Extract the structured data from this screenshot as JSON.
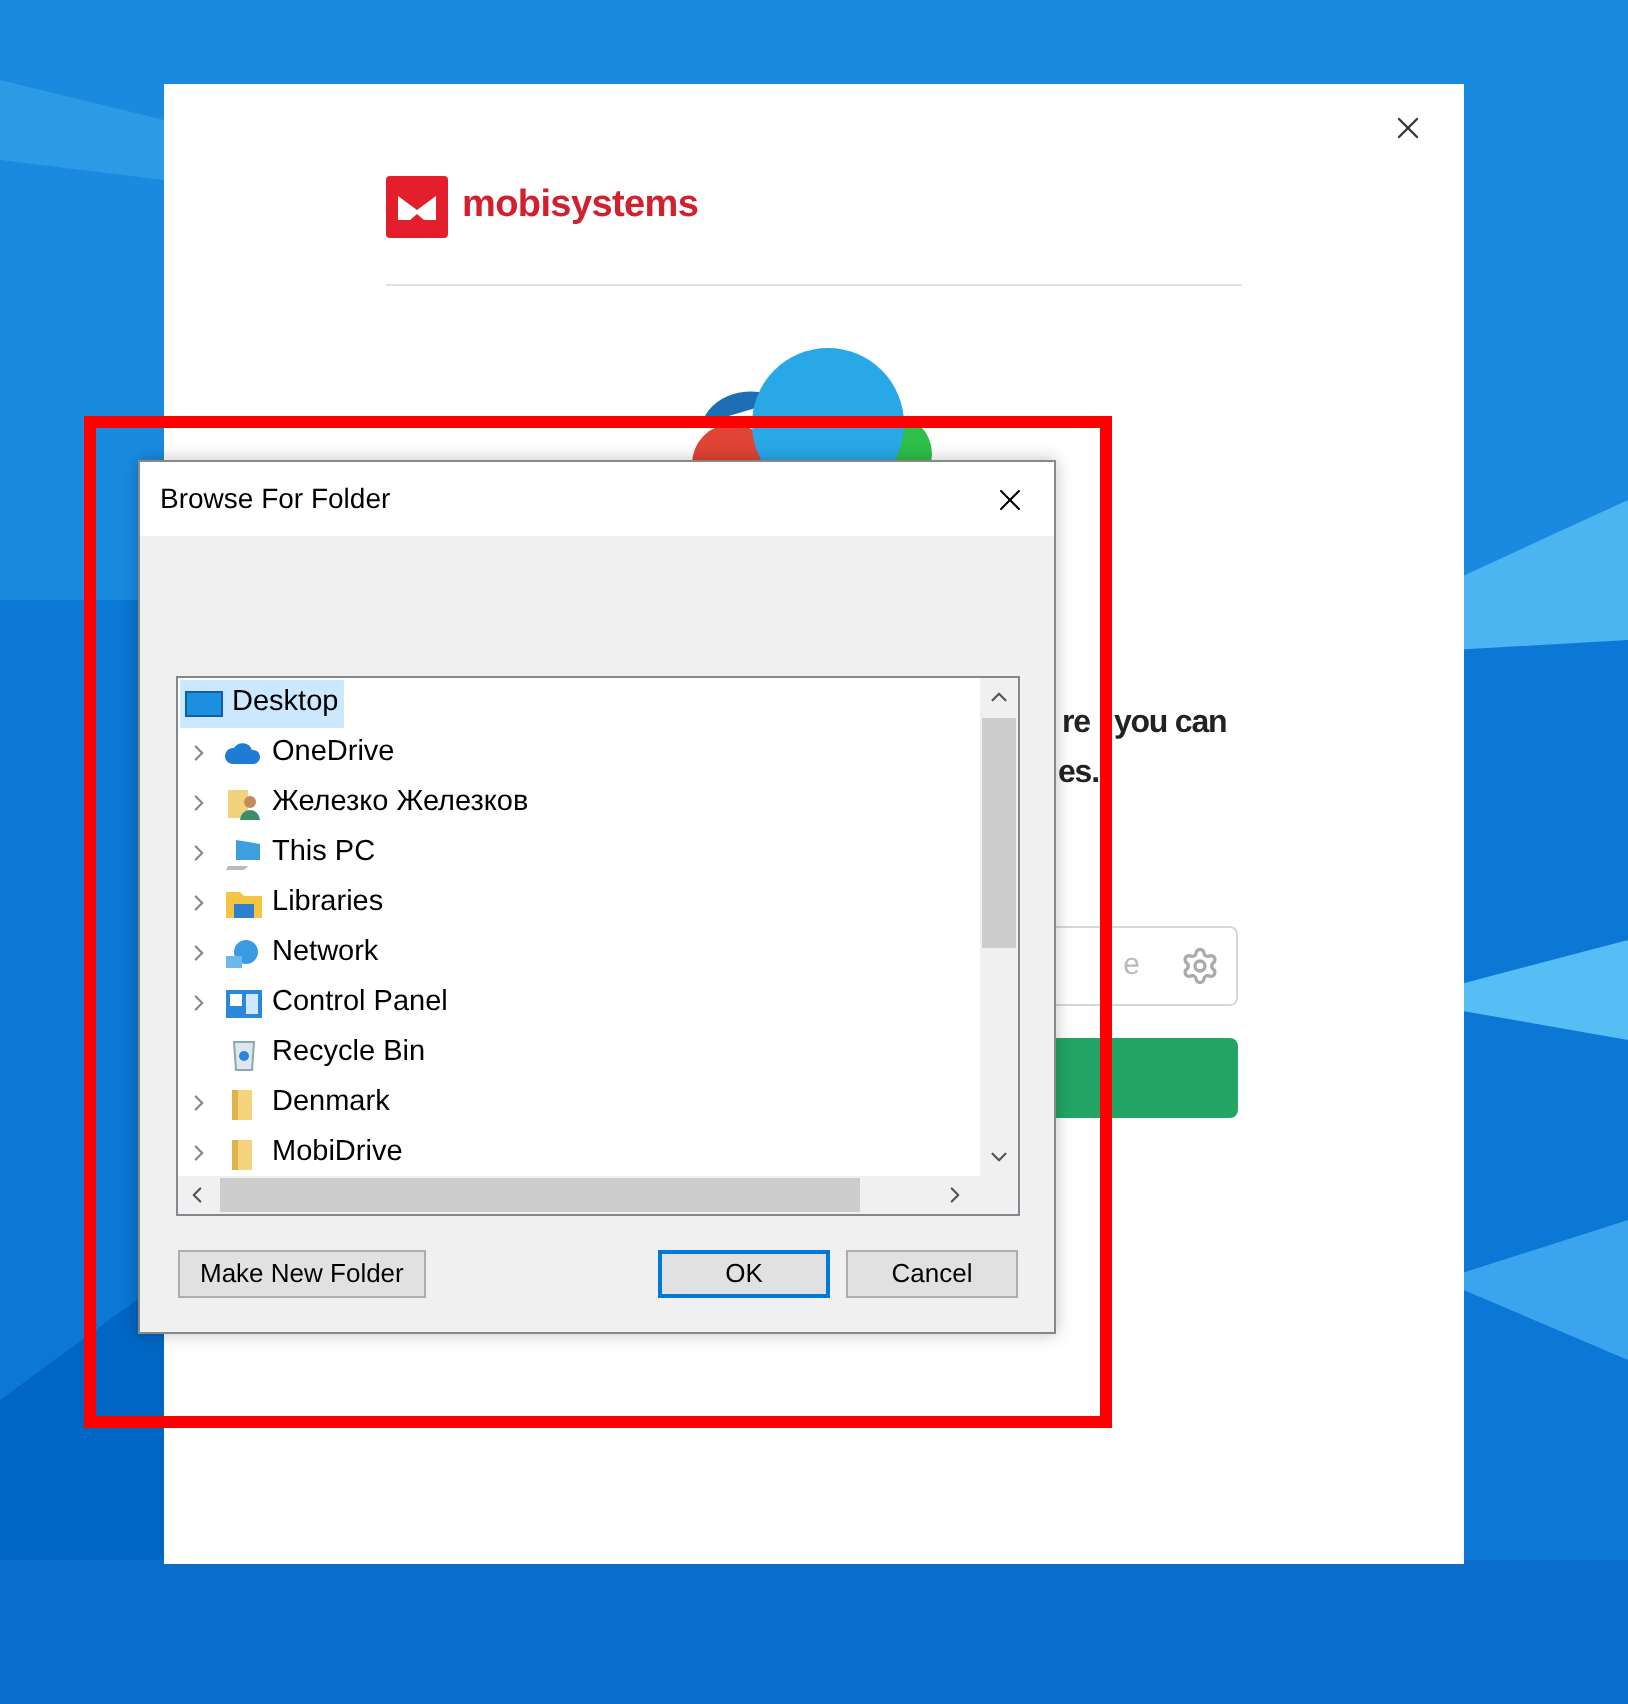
{
  "installer": {
    "brand": "mobisystems",
    "text_lines": [
      [
        "re",
        "you can"
      ],
      [
        "es."
      ]
    ],
    "field": {
      "placeholder": "e"
    }
  },
  "dialog": {
    "title": "Browse For Folder",
    "tree": {
      "items": [
        {
          "name": "Desktop",
          "kind": "desktop",
          "expandable": false,
          "selected": true
        },
        {
          "name": "OneDrive",
          "kind": "cloud",
          "expandable": true,
          "selected": false
        },
        {
          "name": "Железко Железков",
          "kind": "user",
          "expandable": true,
          "selected": false
        },
        {
          "name": "This PC",
          "kind": "pc",
          "expandable": true,
          "selected": false
        },
        {
          "name": "Libraries",
          "kind": "library",
          "expandable": true,
          "selected": false
        },
        {
          "name": "Network",
          "kind": "network",
          "expandable": true,
          "selected": false
        },
        {
          "name": "Control Panel",
          "kind": "control-panel",
          "expandable": true,
          "selected": false
        },
        {
          "name": "Recycle Bin",
          "kind": "recycle",
          "expandable": false,
          "selected": false
        },
        {
          "name": "Denmark",
          "kind": "folder",
          "expandable": true,
          "selected": false
        },
        {
          "name": "MobiDrive",
          "kind": "folder",
          "expandable": true,
          "selected": false
        }
      ]
    },
    "buttons": [
      {
        "label": "Make New Folder",
        "default": false
      },
      {
        "label": "OK",
        "default": true
      },
      {
        "label": "Cancel",
        "default": false
      }
    ]
  }
}
